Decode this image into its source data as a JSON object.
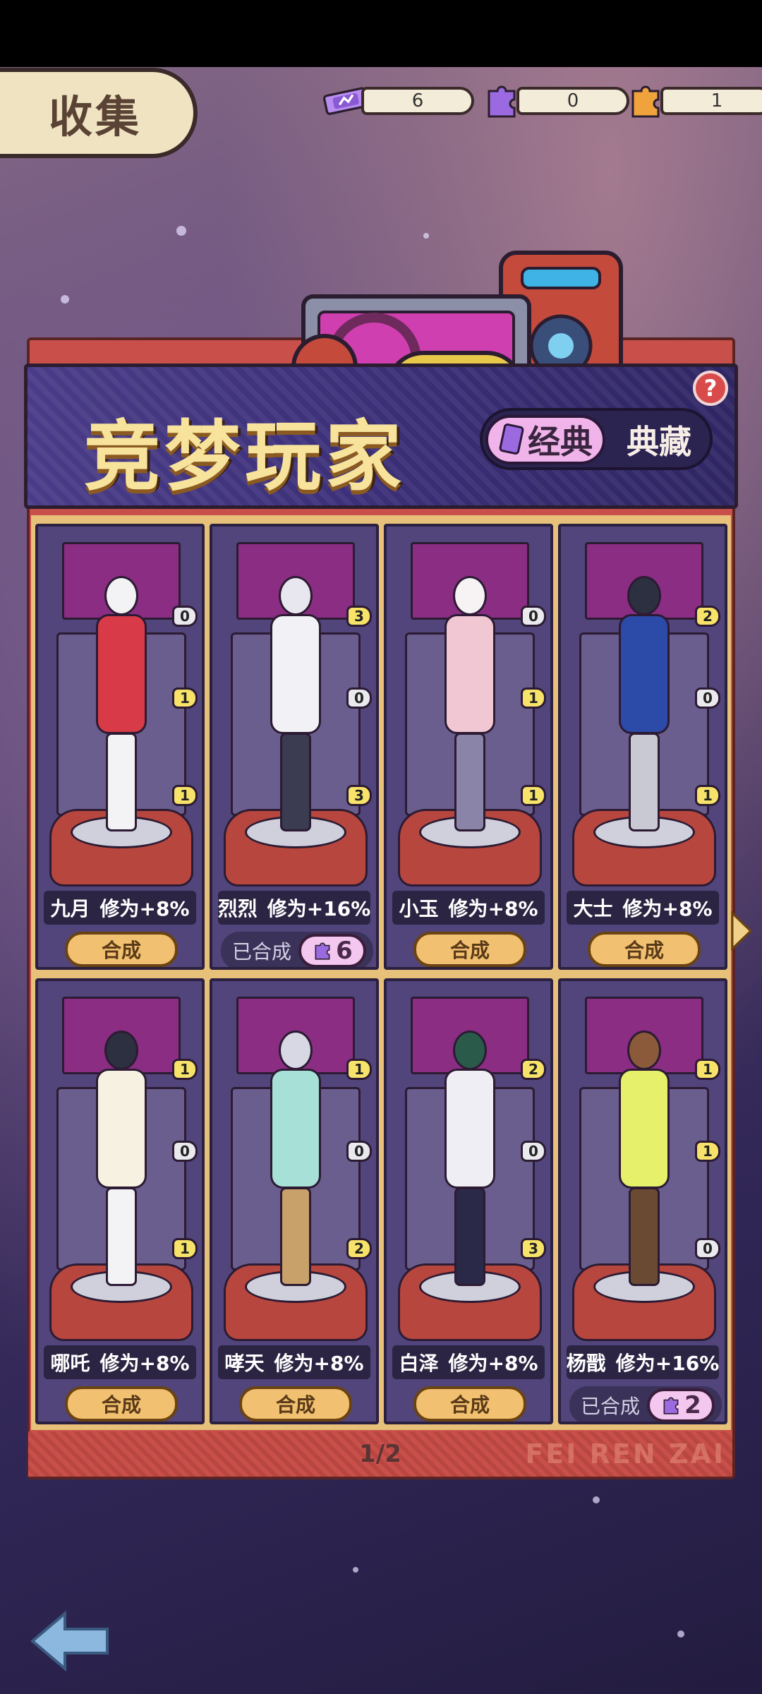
{
  "header": {
    "title": "收集",
    "resources": [
      {
        "icon": "ticket-icon",
        "value": "6"
      },
      {
        "icon": "puzzle-piece-icon",
        "value": "0"
      },
      {
        "icon": "star-puzzle-icon",
        "value": "1"
      }
    ]
  },
  "banner": {
    "title": "竞梦玩家",
    "tabs": {
      "active": "经典",
      "inactive": "典藏"
    },
    "help": "?"
  },
  "cards": [
    {
      "name": "九月",
      "bonus": "修为+8%",
      "counts": [
        "0",
        "1",
        "1"
      ],
      "action": "合成",
      "merged": false
    },
    {
      "name": "烈烈",
      "bonus": "修为+16%",
      "counts": [
        "3",
        "0",
        "3"
      ],
      "merged": true,
      "merged_label": "已合成",
      "pieces": "6"
    },
    {
      "name": "小玉",
      "bonus": "修为+8%",
      "counts": [
        "0",
        "1",
        "1"
      ],
      "action": "合成",
      "merged": false
    },
    {
      "name": "大士",
      "bonus": "修为+8%",
      "counts": [
        "2",
        "0",
        "1"
      ],
      "action": "合成",
      "merged": false
    },
    {
      "name": "哪吒",
      "bonus": "修为+8%",
      "counts": [
        "1",
        "0",
        "1"
      ],
      "action": "合成",
      "merged": false
    },
    {
      "name": "哮天",
      "bonus": "修为+8%",
      "counts": [
        "1",
        "0",
        "2"
      ],
      "action": "合成",
      "merged": false
    },
    {
      "name": "白泽",
      "bonus": "修为+8%",
      "counts": [
        "2",
        "0",
        "3"
      ],
      "action": "合成",
      "merged": false
    },
    {
      "name": "杨戬",
      "bonus": "修为+16%",
      "counts": [
        "1",
        "1",
        "0"
      ],
      "merged": true,
      "merged_label": "已合成",
      "pieces": "2"
    }
  ],
  "footer": {
    "page": "1/2",
    "watermark": "FEI REN ZAI"
  },
  "colors": {
    "accent": "#f1c070",
    "panel": "#c9504a",
    "banner": "#3b2f78",
    "pink": "#f1b4ea"
  }
}
